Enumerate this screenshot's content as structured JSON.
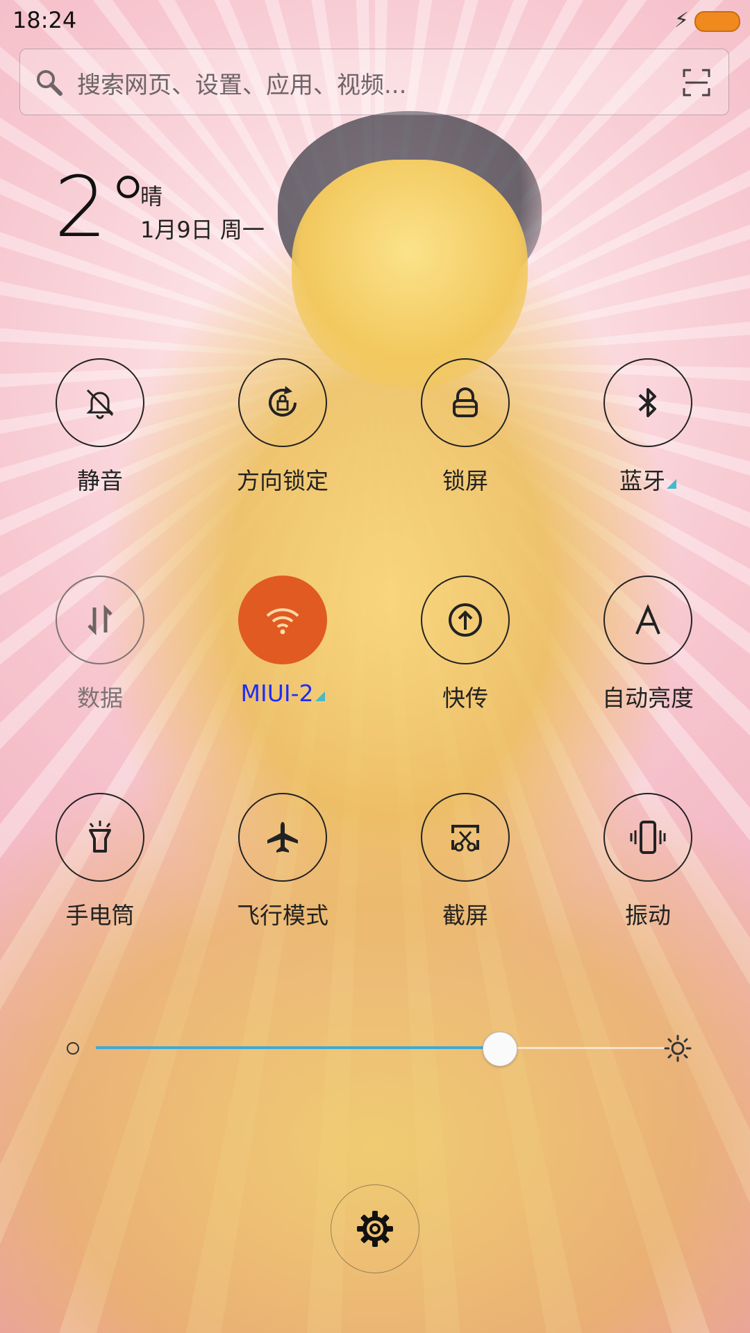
{
  "status_bar": {
    "time": "18:24",
    "charging_icon": "bolt-icon",
    "battery_color": "#f08a1e"
  },
  "search": {
    "placeholder": "搜索网页、设置、应用、视频...",
    "search_icon": "search-icon",
    "scan_icon": "scan-icon"
  },
  "weather": {
    "temperature": "2°",
    "condition": "晴",
    "date": "1月9日 周一"
  },
  "toggles": [
    {
      "label": "静音",
      "icon": "bell-off-icon",
      "state": "off"
    },
    {
      "label": "方向锁定",
      "icon": "rotation-lock-icon",
      "state": "off"
    },
    {
      "label": "锁屏",
      "icon": "lock-icon",
      "state": "off"
    },
    {
      "label": "蓝牙",
      "icon": "bluetooth-icon",
      "state": "off",
      "has_more": true
    },
    {
      "label": "数据",
      "icon": "mobile-data-icon",
      "state": "disabled"
    },
    {
      "label": "MIUI-2",
      "icon": "wifi-icon",
      "state": "on",
      "has_more": true
    },
    {
      "label": "快传",
      "icon": "share-icon",
      "state": "off"
    },
    {
      "label": "自动亮度",
      "icon": "auto-brightness-icon",
      "state": "off"
    },
    {
      "label": "手电筒",
      "icon": "flashlight-icon",
      "state": "off"
    },
    {
      "label": "飞行模式",
      "icon": "airplane-icon",
      "state": "off"
    },
    {
      "label": "截屏",
      "icon": "screenshot-icon",
      "state": "off"
    },
    {
      "label": "振动",
      "icon": "vibrate-icon",
      "state": "off"
    }
  ],
  "brightness": {
    "level": 0.7
  },
  "colors": {
    "active": "#e05a22",
    "wifi_label": "#1c2cff",
    "slider_fill": "#3fa9d4"
  }
}
